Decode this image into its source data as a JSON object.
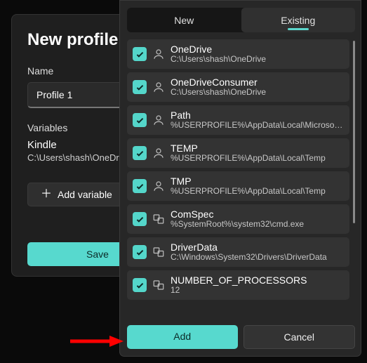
{
  "back": {
    "title": "New profile",
    "nameLabel": "Name",
    "nameValue": "Profile 1",
    "variablesLabel": "Variables",
    "variable": {
      "name": "Kindle",
      "value": "C:\\Users\\shash\\OneDrive"
    },
    "addVariable": "Add variable",
    "save": "Save"
  },
  "tabs": {
    "new": "New",
    "existing": "Existing",
    "active": "existing"
  },
  "items": [
    {
      "checked": true,
      "icon": "user",
      "title": "OneDrive",
      "sub": "C:\\Users\\shash\\OneDrive"
    },
    {
      "checked": true,
      "icon": "user",
      "title": "OneDriveConsumer",
      "sub": "C:\\Users\\shash\\OneDrive"
    },
    {
      "checked": true,
      "icon": "user",
      "title": "Path",
      "sub": "%USERPROFILE%\\AppData\\Local\\Microsoft\\..."
    },
    {
      "checked": true,
      "icon": "user",
      "title": "TEMP",
      "sub": "%USERPROFILE%\\AppData\\Local\\Temp"
    },
    {
      "checked": true,
      "icon": "user",
      "title": "TMP",
      "sub": "%USERPROFILE%\\AppData\\Local\\Temp"
    },
    {
      "checked": true,
      "icon": "system",
      "title": "ComSpec",
      "sub": "%SystemRoot%\\system32\\cmd.exe"
    },
    {
      "checked": true,
      "icon": "system",
      "title": "DriverData",
      "sub": "C:\\Windows\\System32\\Drivers\\DriverData"
    },
    {
      "checked": true,
      "icon": "system",
      "title": "NUMBER_OF_PROCESSORS",
      "sub": "12"
    }
  ],
  "buttons": {
    "add": "Add",
    "cancel": "Cancel"
  }
}
